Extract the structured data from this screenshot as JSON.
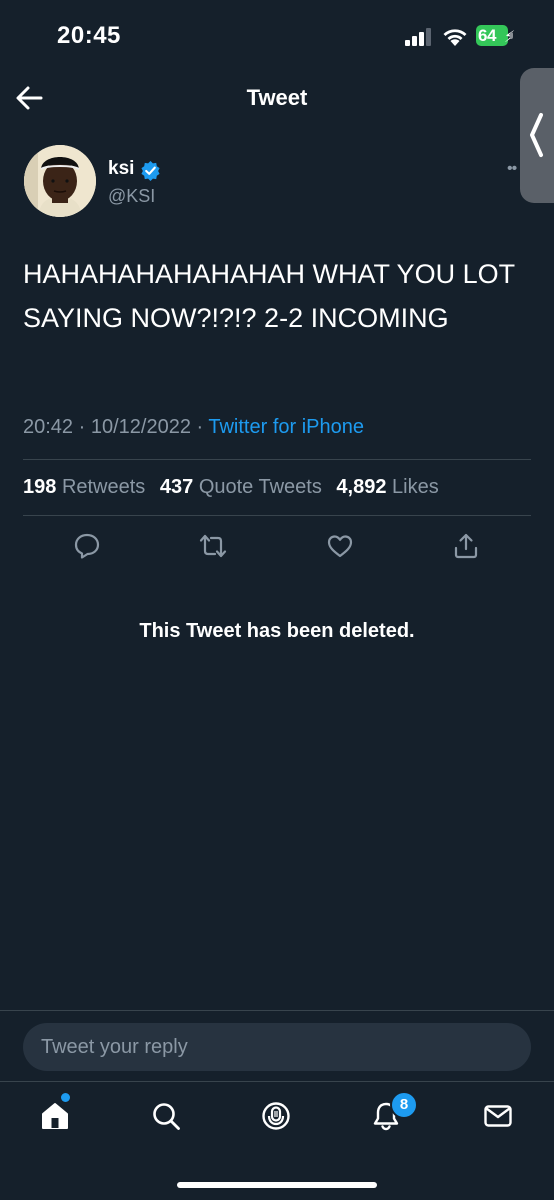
{
  "status_bar": {
    "time": "20:45",
    "battery": "64",
    "icons": [
      "cellular-signal-icon",
      "wifi-icon",
      "battery-charging-icon"
    ]
  },
  "header": {
    "title": "Tweet",
    "back_icon": "back-arrow-icon"
  },
  "tweet": {
    "author_name": "ksi",
    "author_handle": "@KSI",
    "verified": true,
    "text": "HAHAHAHAHAHAHAH WHAT YOU LOT SAYING NOW?!?!? 2-2 INCOMING",
    "time": "20:42",
    "date": "10/12/2022",
    "source": "Twitter for iPhone",
    "stats": {
      "retweets_count": "198",
      "retweets_label": "Retweets",
      "quotes_count": "437",
      "quotes_label": "Quote Tweets",
      "likes_count": "4,892",
      "likes_label": "Likes"
    },
    "actions": [
      "reply-icon",
      "retweet-icon",
      "like-icon",
      "share-icon"
    ]
  },
  "deleted_notice": "This Tweet has been deleted.",
  "reply": {
    "placeholder": "Tweet your reply"
  },
  "tab_bar": {
    "items": [
      "home-icon",
      "search-icon",
      "spaces-icon",
      "notifications-icon",
      "messages-icon"
    ],
    "notifications_badge": "8"
  },
  "colors": {
    "background": "#15202b",
    "accent": "#1d9bf0",
    "secondary_text": "#8b98a5",
    "divider": "#38444d",
    "battery": "#34c759"
  }
}
